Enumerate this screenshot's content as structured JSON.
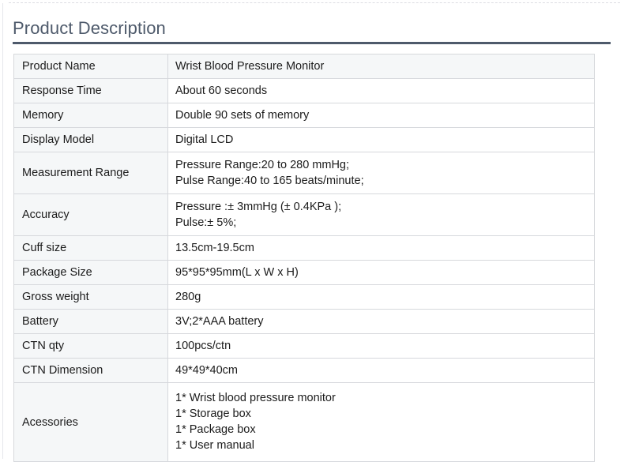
{
  "page": {
    "title": "Product Description"
  },
  "table": {
    "rows": [
      {
        "label": "Product Name",
        "lines": [
          "Wrist Blood Pressure Monitor"
        ]
      },
      {
        "label": "Response Time",
        "lines": [
          "About 60 seconds"
        ]
      },
      {
        "label": "Memory",
        "lines": [
          "Double 90 sets of memory"
        ]
      },
      {
        "label": "Display Model",
        "lines": [
          "Digital LCD"
        ]
      },
      {
        "label": "Measurement Range",
        "lines": [
          "Pressure Range:20 to 280 mmHg;",
          "Pulse Range:40 to 165 beats/minute;"
        ]
      },
      {
        "label": "Accuracy",
        "lines": [
          "Pressure :± 3mmHg (± 0.4KPa );",
          "Pulse:± 5%;"
        ]
      },
      {
        "label": "Cuff size",
        "lines": [
          "13.5cm-19.5cm"
        ]
      },
      {
        "label": "Package Size",
        "lines": [
          "95*95*95mm(L x W x H)"
        ]
      },
      {
        "label": "Gross weight",
        "lines": [
          "280g"
        ]
      },
      {
        "label": "Battery",
        "lines": [
          "3V;2*AAA battery"
        ]
      },
      {
        "label": "CTN qty",
        "lines": [
          "100pcs/ctn"
        ]
      },
      {
        "label": "CTN Dimension",
        "lines": [
          "49*49*40cm"
        ]
      },
      {
        "label": "Acessories",
        "lines": [
          "1* Wrist blood pressure monitor",
          "1* Storage box",
          "1* Package box",
          "1* User manual"
        ]
      }
    ]
  },
  "colors": {
    "title_text": "#4e5a6b",
    "title_rule": "#4e5a6b",
    "label_cell_background": "#f5f7f8",
    "value_cell_background": "#ffffff",
    "cell_border": "#d6d8dc",
    "body_text": "#1b1b1b"
  }
}
